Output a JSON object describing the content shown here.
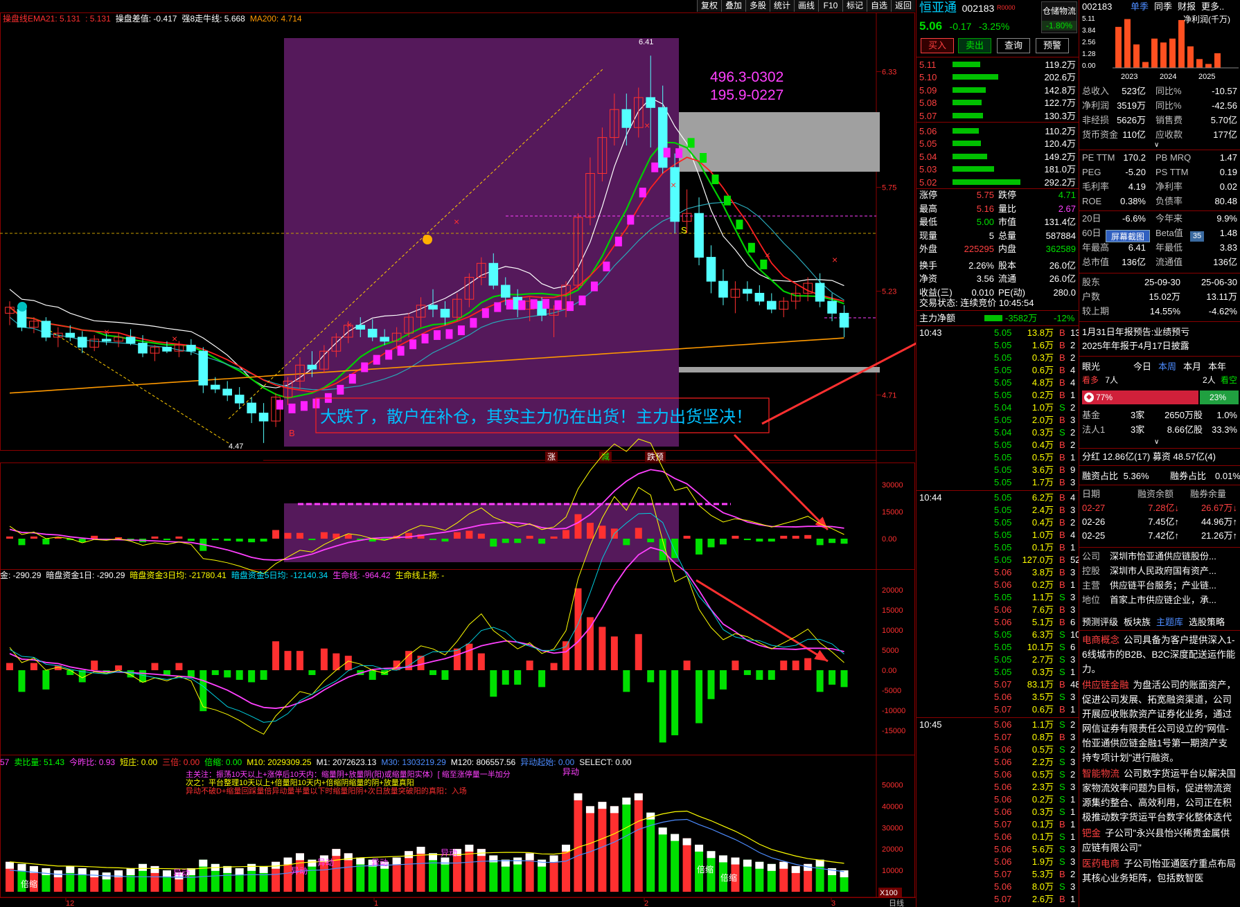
{
  "toolbar": {
    "buttons": [
      "复权",
      "叠加",
      "多股",
      "统计",
      "画线",
      "F10",
      "标记",
      "自选",
      "返回"
    ]
  },
  "indicators": {
    "main": [
      {
        "label": "操盘线EMA21: 5.131",
        "color": "#ff3030"
      },
      {
        "label": ": 5.131",
        "color": "#ff3030"
      },
      {
        "label": "操盘差值: -0.417",
        "color": "#ffffff"
      },
      {
        "label": "强8走牛线: 5.668",
        "color": "#ffffff"
      },
      {
        "label": "MA200: 4.714",
        "color": "#ff9900"
      }
    ],
    "mid": [
      {
        "label": "金: -290.29",
        "color": "#ffffff"
      },
      {
        "label": "暗盘资金1日: -290.29",
        "color": "#ffffff"
      },
      {
        "label": "暗盘资金3日均: -21780.41",
        "color": "#ffff00"
      },
      {
        "label": "暗盘资金5日均: -12140.34",
        "color": "#00e0ff"
      },
      {
        "label": "生命线: -964.42",
        "color": "#ff40ff"
      },
      {
        "label": "生命线上扬: -",
        "color": "#ffff00"
      }
    ],
    "vol": [
      {
        "label": "57",
        "color": "#ff40ff"
      },
      {
        "label": "卖比量: 51.43",
        "color": "#00ff00"
      },
      {
        "label": "今昨比: 0.93",
        "color": "#ff40ff"
      },
      {
        "label": "短庄: 0.00",
        "color": "#ffff00"
      },
      {
        "label": "三倍: 0.00",
        "color": "#ff3030"
      },
      {
        "label": "倍缩: 0.00",
        "color": "#00ff00"
      },
      {
        "label": "M10: 2029309.25",
        "color": "#ffff00"
      },
      {
        "label": "M1: 2072623.13",
        "color": "#ffffff"
      },
      {
        "label": "M30: 1303219.29",
        "color": "#4d8cff"
      },
      {
        "label": "M120: 806557.56",
        "color": "#ffffff"
      },
      {
        "label": "异动起始: 0.00",
        "color": "#4d8cff"
      },
      {
        "label": "SELECT: 0.00",
        "color": "#ffffff"
      }
    ],
    "vol_notes": [
      "主关注：振荡10天以上+涨停后10天内：缩量阴+放量阴(阳)或缩量阳实体）[ 缩至涨停量一半加分",
      "次之：平台整理10天以上+倍量阳10天内+倍缩阴缩量的阴+放量真阳",
      "异动不破D+缩量回踩量倍异动量半量以下时缩量阳阴+次日放量突破阳的真阳：入场"
    ]
  },
  "annotations": {
    "box_label_1": "496.3-0302",
    "box_label_2": "195.9-0227",
    "callout": "大跌了，散户在补仓，其实主力仍在出货！主力出货坚决！",
    "high_label": "6.41",
    "low_label": "4.47",
    "marker_b": "B",
    "marker_s": "S",
    "tags": [
      "涨",
      "减",
      "跌预"
    ],
    "yidong": "异动",
    "beisuo": "倍缩",
    "x100": "X100"
  },
  "axes": {
    "price": [
      "6.33",
      "5.75",
      "5.23",
      "4.71"
    ],
    "macd": [
      "30000",
      "15000",
      "0.00"
    ],
    "fund": [
      "20000",
      "15000",
      "10000",
      "5000",
      "0.00",
      "-5000",
      "-10000",
      "-15000"
    ],
    "vol": [
      "50000",
      "40000",
      "30000",
      "20000",
      "10000"
    ],
    "dates": [
      "12",
      "1",
      "2",
      "3"
    ],
    "period": "日线"
  },
  "chart_data": {
    "type": "candlestick",
    "series_name": "恒亚通 002183",
    "candles": [
      [
        5.12,
        5.18,
        5.06,
        5.15
      ],
      [
        5.14,
        5.16,
        5.03,
        5.05
      ],
      [
        5.05,
        5.1,
        5.02,
        5.08
      ],
      [
        5.08,
        5.1,
        4.98,
        5.0
      ],
      [
        5.0,
        5.05,
        4.95,
        5.02
      ],
      [
        5.02,
        5.06,
        4.98,
        5.0
      ],
      [
        5.0,
        5.03,
        4.92,
        4.95
      ],
      [
        4.95,
        5.01,
        4.93,
        4.99
      ],
      [
        4.99,
        5.02,
        4.96,
        4.98
      ],
      [
        4.98,
        5.02,
        4.95,
        5.0
      ],
      [
        5.0,
        5.04,
        4.96,
        4.97
      ],
      [
        4.97,
        5.01,
        4.9,
        4.92
      ],
      [
        4.92,
        4.96,
        4.88,
        4.95
      ],
      [
        4.95,
        4.98,
        4.92,
        4.93
      ],
      [
        4.93,
        4.98,
        4.9,
        4.96
      ],
      [
        4.96,
        4.99,
        4.91,
        4.93
      ],
      [
        4.93,
        4.95,
        4.72,
        4.76
      ],
      [
        4.76,
        4.8,
        4.72,
        4.74
      ],
      [
        4.74,
        4.78,
        4.68,
        4.71
      ],
      [
        4.71,
        4.75,
        4.64,
        4.67
      ],
      [
        4.67,
        4.7,
        4.57,
        4.62
      ],
      [
        4.62,
        4.67,
        4.47,
        4.58
      ],
      [
        4.58,
        4.72,
        4.55,
        4.7
      ],
      [
        4.7,
        4.8,
        4.66,
        4.78
      ],
      [
        4.78,
        4.9,
        4.74,
        4.86
      ],
      [
        4.86,
        4.93,
        4.8,
        4.84
      ],
      [
        4.84,
        4.96,
        4.82,
        4.93
      ],
      [
        4.93,
        5.02,
        4.9,
        5.0
      ],
      [
        5.0,
        5.08,
        4.97,
        5.06
      ],
      [
        5.06,
        5.1,
        5.0,
        5.04
      ],
      [
        5.04,
        5.09,
        4.98,
        5.0
      ],
      [
        5.0,
        5.04,
        4.96,
        4.98
      ],
      [
        4.98,
        5.05,
        4.94,
        5.02
      ],
      [
        5.02,
        5.12,
        5.0,
        5.1
      ],
      [
        5.1,
        5.2,
        5.05,
        5.16
      ],
      [
        5.16,
        5.24,
        5.1,
        5.14
      ],
      [
        5.14,
        5.18,
        5.06,
        5.1
      ],
      [
        5.1,
        5.22,
        5.08,
        5.19
      ],
      [
        5.19,
        5.32,
        5.15,
        5.3
      ],
      [
        5.3,
        5.4,
        5.26,
        5.37
      ],
      [
        5.37,
        5.42,
        5.24,
        5.26
      ],
      [
        5.26,
        5.3,
        5.16,
        5.2
      ],
      [
        5.2,
        5.24,
        5.1,
        5.14
      ],
      [
        5.14,
        5.2,
        5.08,
        5.18
      ],
      [
        5.18,
        5.2,
        5.08,
        5.11
      ],
      [
        5.11,
        5.16,
        5.0,
        5.14
      ],
      [
        5.14,
        5.28,
        5.1,
        5.26
      ],
      [
        5.26,
        5.62,
        5.24,
        5.6
      ],
      [
        5.6,
        5.9,
        5.56,
        5.82
      ],
      [
        5.82,
        6.05,
        5.78,
        6.0
      ],
      [
        6.0,
        6.22,
        5.96,
        6.14
      ],
      [
        6.14,
        6.22,
        5.96,
        6.05
      ],
      [
        6.05,
        6.25,
        6.0,
        6.2
      ],
      [
        6.2,
        6.41,
        5.95,
        6.15
      ],
      [
        6.15,
        6.26,
        5.82,
        5.85
      ],
      [
        5.85,
        5.92,
        5.52,
        5.58
      ],
      [
        5.58,
        5.74,
        5.52,
        5.62
      ],
      [
        5.62,
        5.7,
        5.36,
        5.4
      ],
      [
        5.4,
        5.46,
        5.22,
        5.28
      ],
      [
        5.28,
        5.34,
        5.16,
        5.2
      ],
      [
        5.2,
        5.28,
        5.12,
        5.24
      ],
      [
        5.24,
        5.28,
        5.18,
        5.22
      ],
      [
        5.22,
        5.26,
        5.16,
        5.18
      ],
      [
        5.18,
        5.22,
        5.12,
        5.14
      ],
      [
        5.14,
        5.2,
        5.1,
        5.18
      ],
      [
        5.18,
        5.26,
        5.14,
        5.22
      ],
      [
        5.22,
        5.3,
        5.18,
        5.27
      ],
      [
        5.27,
        5.32,
        5.15,
        5.18
      ],
      [
        5.18,
        5.22,
        5.08,
        5.12
      ],
      [
        5.12,
        5.16,
        5.0,
        5.05
      ]
    ],
    "ylim": [
      4.4,
      6.55
    ],
    "volumes": [
      14,
      13,
      12,
      11,
      10,
      12,
      11,
      10,
      9,
      10,
      11,
      13,
      12,
      10,
      9,
      11,
      15,
      13,
      12,
      11,
      13,
      12,
      14,
      16,
      18,
      15,
      17,
      20,
      18,
      16,
      15,
      14,
      16,
      19,
      21,
      18,
      16,
      20,
      22,
      20,
      17,
      15,
      16,
      18,
      15,
      17,
      22,
      46,
      40,
      42,
      40,
      44,
      46,
      37,
      30,
      27,
      25,
      22,
      19,
      17,
      16,
      15,
      14,
      13,
      14,
      12,
      13,
      15,
      11,
      10
    ],
    "vol_ylim": [
      0,
      55000
    ]
  },
  "quote": {
    "name": "恒亚通",
    "code": "002183",
    "flag": "R0000",
    "price": "5.06",
    "change": "-0.17",
    "pct": "-3.25%",
    "sector": "仓储物流",
    "sector_pct": "-1.80%",
    "buttons": [
      "买入",
      "卖出",
      "查询",
      "预警"
    ],
    "asks": [
      [
        "5.11",
        "119.2万",
        40
      ],
      [
        "5.10",
        "202.6万",
        66
      ],
      [
        "5.09",
        "142.8万",
        48
      ],
      [
        "5.08",
        "122.7万",
        42
      ],
      [
        "5.07",
        "130.3万",
        44
      ]
    ],
    "bids": [
      [
        "5.06",
        "110.2万",
        38
      ],
      [
        "5.05",
        "120.4万",
        41
      ],
      [
        "5.04",
        "149.2万",
        50
      ],
      [
        "5.03",
        "181.0万",
        60
      ],
      [
        "5.02",
        "292.2万",
        98
      ]
    ],
    "stats": [
      [
        "涨停",
        "5.75",
        "red",
        "跌停",
        "4.71",
        "grn"
      ],
      [
        "最高",
        "5.16",
        "red",
        "量比",
        "2.67",
        "mag"
      ],
      [
        "最低",
        "5.00",
        "grn",
        "市值",
        "131.4亿",
        "wht"
      ],
      [
        "现量",
        "5",
        "wht",
        "总量",
        "587884",
        "wht"
      ],
      [
        "外盘",
        "225295",
        "red",
        "内盘",
        "362589",
        "grn"
      ],
      [
        "换手",
        "2.26%",
        "wht",
        "股本",
        "26.0亿",
        "wht"
      ],
      [
        "净资",
        "3.56",
        "wht",
        "流通",
        "26.0亿",
        "wht"
      ],
      [
        "收益(三)",
        "0.010",
        "wht",
        "PE(动)",
        "280.0",
        "wht"
      ]
    ],
    "trade_state": "交易状态: 连续竞价 10:45:54",
    "main_flow_label": "主力净额",
    "main_flow_value": "-3582万",
    "main_flow_pct": "-12%",
    "ticks": [
      {
        "time": "10:43",
        "price": "5.05",
        "vol": "13.8万",
        "bs": "B",
        "n": "13"
      },
      {
        "price": "5.05",
        "vol": "1.6万",
        "bs": "B",
        "n": "2"
      },
      {
        "price": "5.05",
        "vol": "0.3万",
        "bs": "B",
        "n": "2"
      },
      {
        "price": "5.05",
        "vol": "0.6万",
        "bs": "B",
        "n": "4"
      },
      {
        "price": "5.05",
        "vol": "4.8万",
        "bs": "B",
        "n": "4"
      },
      {
        "price": "5.05",
        "vol": "0.2万",
        "bs": "B",
        "n": "1"
      },
      {
        "price": "5.04",
        "vol": "1.0万",
        "bs": "S",
        "n": "2"
      },
      {
        "price": "5.05",
        "vol": "2.0万",
        "bs": "B",
        "n": "3"
      },
      {
        "price": "5.04",
        "vol": "0.3万",
        "bs": "S",
        "n": "2"
      },
      {
        "price": "5.05",
        "vol": "0.4万",
        "bs": "B",
        "n": "2"
      },
      {
        "price": "5.05",
        "vol": "0.5万",
        "bs": "B",
        "n": "1"
      },
      {
        "price": "5.05",
        "vol": "3.6万",
        "bs": "B",
        "n": "9"
      },
      {
        "price": "5.05",
        "vol": "1.7万",
        "bs": "B",
        "n": "3"
      },
      {
        "time": "10:44",
        "price": "5.05",
        "vol": "6.2万",
        "bs": "B",
        "n": "4"
      },
      {
        "price": "5.05",
        "vol": "2.4万",
        "bs": "B",
        "n": "3"
      },
      {
        "price": "5.05",
        "vol": "0.4万",
        "bs": "B",
        "n": "2"
      },
      {
        "price": "5.05",
        "vol": "1.0万",
        "bs": "B",
        "n": "4"
      },
      {
        "price": "5.05",
        "vol": "0.1万",
        "bs": "B",
        "n": "1"
      },
      {
        "price": "5.05",
        "vol": "127.0万",
        "bs": "B",
        "n": "52"
      },
      {
        "price": "5.06",
        "vol": "3.8万",
        "bs": "B",
        "n": "3"
      },
      {
        "price": "5.06",
        "vol": "0.2万",
        "bs": "B",
        "n": "1"
      },
      {
        "price": "5.05",
        "vol": "1.1万",
        "bs": "S",
        "n": "3"
      },
      {
        "price": "5.06",
        "vol": "7.6万",
        "bs": "B",
        "n": "3"
      },
      {
        "price": "5.06",
        "vol": "5.1万",
        "bs": "B",
        "n": "6"
      },
      {
        "price": "5.05",
        "vol": "6.3万",
        "bs": "S",
        "n": "10"
      },
      {
        "price": "5.05",
        "vol": "10.1万",
        "bs": "S",
        "n": "6"
      },
      {
        "price": "5.05",
        "vol": "2.7万",
        "bs": "S",
        "n": "3"
      },
      {
        "price": "5.05",
        "vol": "0.3万",
        "bs": "S",
        "n": "1"
      },
      {
        "price": "5.07",
        "vol": "83.1万",
        "bs": "B",
        "n": "48"
      },
      {
        "price": "5.06",
        "vol": "3.5万",
        "bs": "S",
        "n": "3"
      },
      {
        "price": "5.07",
        "vol": "0.6万",
        "bs": "B",
        "n": "1"
      },
      {
        "time": "10:45",
        "price": "5.06",
        "vol": "1.1万",
        "bs": "S",
        "n": "2"
      },
      {
        "price": "5.07",
        "vol": "0.8万",
        "bs": "B",
        "n": "3"
      },
      {
        "price": "5.06",
        "vol": "0.5万",
        "bs": "S",
        "n": "2"
      },
      {
        "price": "5.06",
        "vol": "2.2万",
        "bs": "S",
        "n": "3"
      },
      {
        "price": "5.06",
        "vol": "0.5万",
        "bs": "S",
        "n": "2"
      },
      {
        "price": "5.06",
        "vol": "2.3万",
        "bs": "S",
        "n": "3"
      },
      {
        "price": "5.06",
        "vol": "0.2万",
        "bs": "S",
        "n": "1"
      },
      {
        "price": "5.06",
        "vol": "0.3万",
        "bs": "S",
        "n": "1"
      },
      {
        "price": "5.07",
        "vol": "0.1万",
        "bs": "B",
        "n": "1"
      },
      {
        "price": "5.06",
        "vol": "0.1万",
        "bs": "S",
        "n": "1"
      },
      {
        "price": "5.06",
        "vol": "5.6万",
        "bs": "S",
        "n": "3"
      },
      {
        "price": "5.06",
        "vol": "1.9万",
        "bs": "S",
        "n": "3"
      },
      {
        "price": "5.07",
        "vol": "5.3万",
        "bs": "B",
        "n": "2"
      },
      {
        "price": "5.06",
        "vol": "8.0万",
        "bs": "S",
        "n": "3"
      },
      {
        "price": "5.07",
        "vol": "2.6万",
        "bs": "B",
        "n": "1"
      }
    ]
  },
  "f10": {
    "code": "002183",
    "tabs": [
      "单季",
      "同季",
      "财报",
      "更多.."
    ],
    "chart_title": "净利润(千万)",
    "chart_y": [
      "5.11",
      "3.84",
      "2.56",
      "1.28",
      "0.00"
    ],
    "chart_x": [
      "2023",
      "2024",
      "2025"
    ],
    "chart_data": {
      "type": "bar",
      "values": [
        4.2,
        5.0,
        2.4,
        0.6,
        3.0,
        2.6,
        3.0,
        4.9,
        2.2,
        0.9,
        0.4,
        1.5
      ],
      "ylim": [
        0,
        5.11
      ]
    },
    "fin": [
      [
        "总收入",
        "523亿",
        "同比%",
        "-10.57"
      ],
      [
        "净利润",
        "3519万",
        "同比%",
        "-42.56"
      ],
      [
        "非经损",
        "5626万",
        "销售费",
        "5.70亿"
      ],
      [
        "货币资金",
        "110亿",
        "应收款",
        "177亿"
      ]
    ],
    "val": [
      [
        "PE TTM",
        "170.2",
        "PB MRQ",
        "1.47"
      ],
      [
        "PEG",
        "-5.20",
        "PS TTM",
        "0.19"
      ],
      [
        "毛利率",
        "4.19",
        "净利率",
        "0.02"
      ],
      [
        "ROE",
        "0.38%",
        "负债率",
        "80.48"
      ]
    ],
    "perf": [
      [
        "20日",
        "-6.6%",
        "今年来",
        "9.9%"
      ],
      [
        "60日",
        "",
        "Beta值",
        "1.48"
      ],
      [
        "年最高",
        "6.41",
        "年最低",
        "3.83"
      ],
      [
        "总市值",
        "136亿",
        "流通值",
        "136亿"
      ]
    ],
    "screenshot_tip": "屏幕截图",
    "beta_badge": "35",
    "holders_head": [
      "股东",
      "25-09-30",
      "25-06-30"
    ],
    "holders": [
      [
        "户数",
        "15.02万",
        "13.11万"
      ],
      [
        "较上期",
        "14.55%",
        "-4.62%"
      ]
    ],
    "notice_1": "1月31日年报预告:业绩预亏",
    "notice_2": "2025年年报于4月17日披露",
    "view_label": "眼光",
    "view_tabs": [
      "今日",
      "本周",
      "本月",
      "本年"
    ],
    "bull_label": "看多",
    "bull_count": "7人",
    "bear_count": "2人",
    "bear_label": "看空",
    "bull_pct": "77%",
    "bear_pct": "23%",
    "inst": [
      [
        "基金",
        "3家",
        "2650万股",
        "1.0%"
      ],
      [
        "法人1",
        "3家",
        "8.66亿股",
        "33.3%"
      ]
    ],
    "dividend": "分红 12.86亿(17) 募资 48.57亿(4)",
    "margin_line": [
      "融资占比",
      "5.36%",
      "融券占比",
      "0.01%"
    ],
    "margin_head": [
      "日期",
      "融资余额",
      "融券余量"
    ],
    "margin_rows": [
      [
        "02-27",
        "7.28亿↓",
        "26.67万↓"
      ],
      [
        "02-26",
        "7.45亿↑",
        "44.96万↑"
      ],
      [
        "02-25",
        "7.42亿↑",
        "21.26万↑"
      ]
    ],
    "info": [
      [
        "公司",
        "深圳市怡亚通供应链股份..."
      ],
      [
        "控股",
        "深圳市人民政府国有资产..."
      ],
      [
        "主营",
        "供应链平台服务；产业链..."
      ],
      [
        "地位",
        "首家上市供应链企业，承..."
      ]
    ],
    "info_tabs": [
      "预测评级",
      "板块族",
      "主题库",
      "选股策略"
    ],
    "concepts": [
      {
        "tag": "电商概念",
        "text": "公司具备为客户提供深入1-6线城市的B2B、B2C深度配送运作能力。"
      },
      {
        "tag": "供应链金融",
        "text": "为盘活公司的账面资产，促进公司发展、拓宽融资渠道，公司开展应收账款资产证券化业务，通过网信证券有限责任公司设立的\"网信-怡亚通供应链金融1号第一期资产支持专项计划\"进行融资。"
      },
      {
        "tag": "智能物流",
        "text": "公司数字货运平台以解决国家物流效率问题为目标，促进物流资源集约整合、高效利用，公司正在积极推动数字货运平台数字化整体迭代"
      },
      {
        "tag": "钯金",
        "text": "子公司\"永兴县怡兴稀贵金属供应链有限公司\""
      },
      {
        "tag": "医药电商",
        "text": "子公司怡亚通医疗重点布局其核心业务矩阵，包括数智医"
      }
    ]
  },
  "colors": {
    "up": "#ff3030",
    "down": "#54ffff",
    "ma_white": "#ffffff",
    "ma_green": "#00d000",
    "ma_cyan": "#2aa8b8",
    "ma_orange": "#ff9900",
    "box_purple": "#5a1a60"
  }
}
